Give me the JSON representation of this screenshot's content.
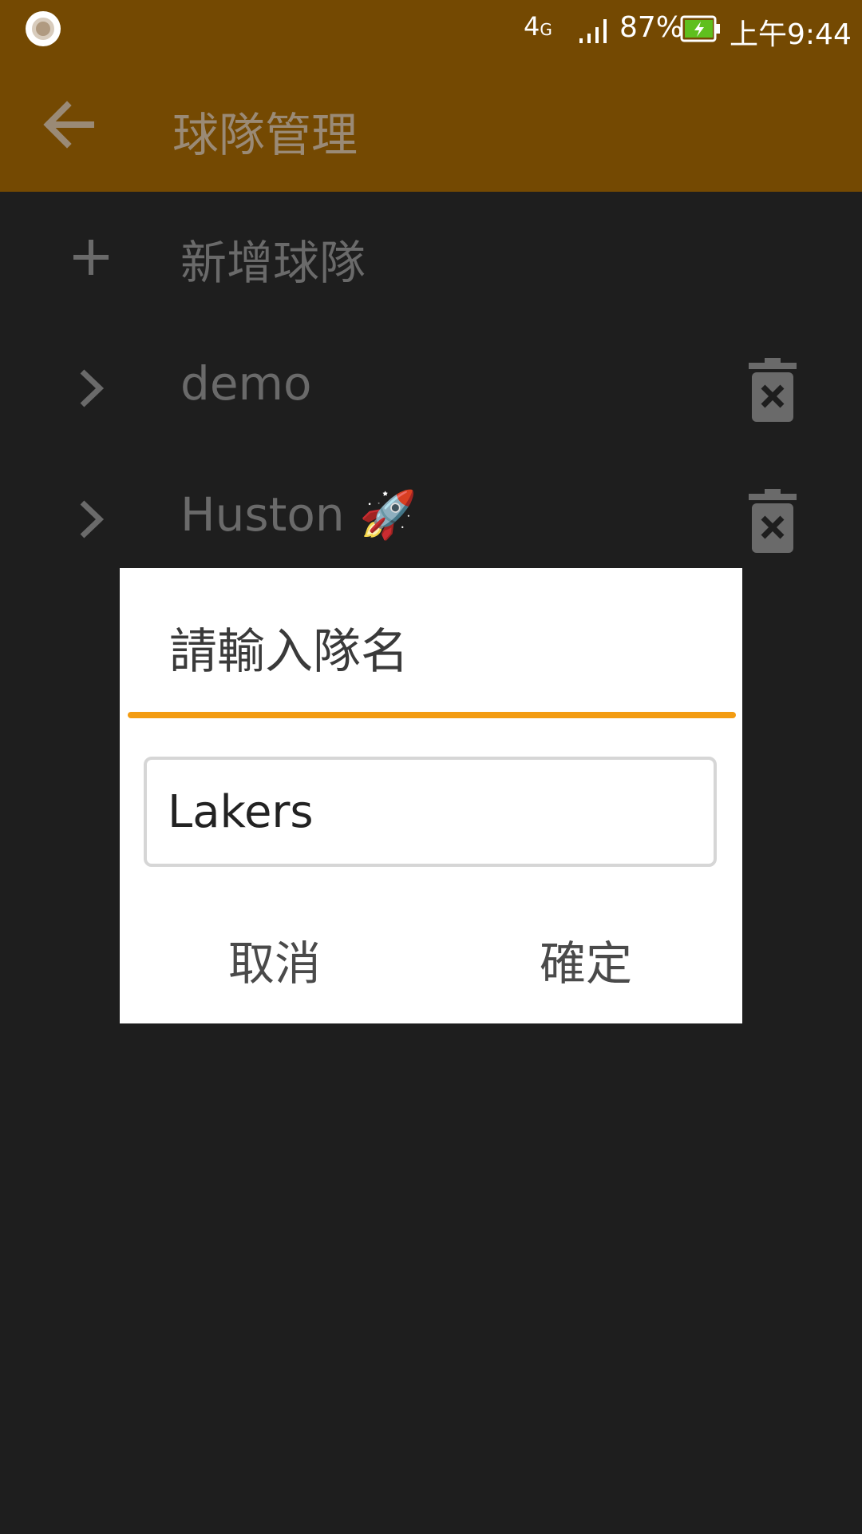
{
  "status_bar": {
    "network": "4",
    "network_sub": "G",
    "battery_percent": "87%",
    "time": "上午9:44",
    "colors": {
      "background": "#744902",
      "battery_fill": "#5fbf1e"
    }
  },
  "app_bar": {
    "title": "球隊管理",
    "back_icon": "arrow-left-icon"
  },
  "list": {
    "add_row": {
      "icon": "plus-icon",
      "label": "新增球隊"
    },
    "teams": [
      {
        "name": "demo",
        "icon": "chevron-right-icon",
        "action_icon": "trash-delete-icon"
      },
      {
        "name": "Huston 🚀",
        "icon": "chevron-right-icon",
        "action_icon": "trash-delete-icon"
      }
    ]
  },
  "dialog": {
    "title": "請輸入隊名",
    "input_value": "Lakers",
    "cancel_label": "取消",
    "confirm_label": "確定",
    "accent_color": "#f39c12"
  }
}
